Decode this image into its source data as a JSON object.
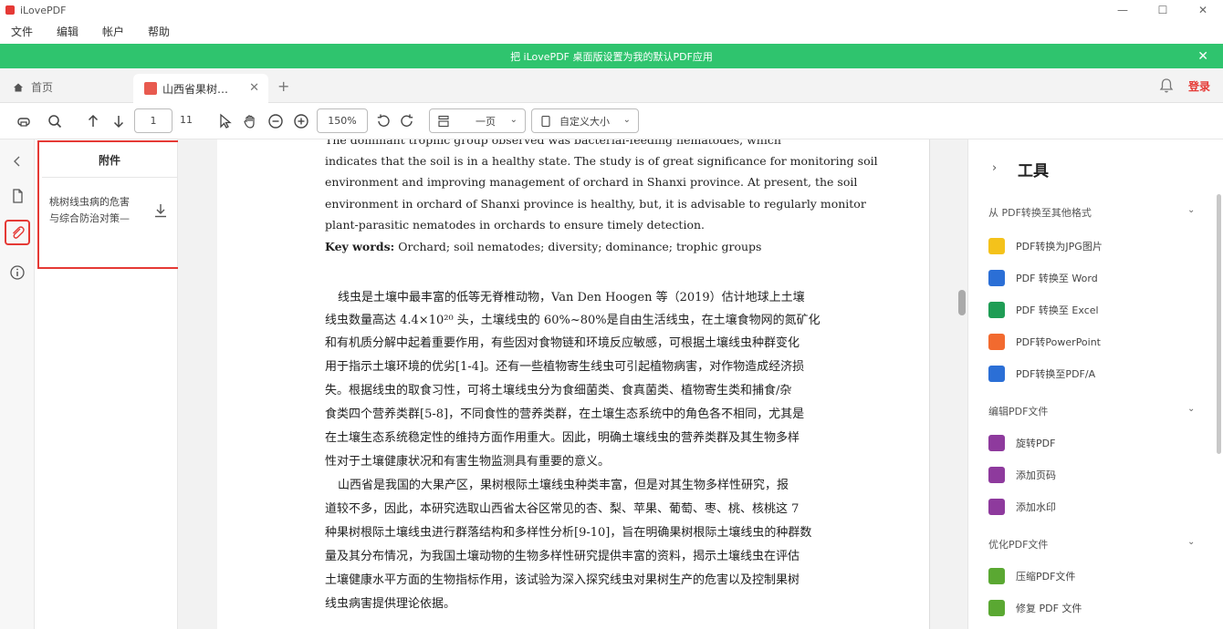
{
  "app": {
    "title": "iLovePDF",
    "window_controls": {
      "minimize": "—",
      "maximize": "☐",
      "close": "✕"
    }
  },
  "menubar": {
    "items": [
      "文件",
      "编辑",
      "帐户",
      "帮助"
    ]
  },
  "banner": {
    "text": "把 iLovePDF 桌面版设置为我的默认PDF应用",
    "close": "✕"
  },
  "tabs": {
    "home": "首页",
    "document": "山西省果树…",
    "close": "✕",
    "add": "+",
    "login": "登录"
  },
  "toolbar": {
    "page_current": "1",
    "page_total": "11",
    "zoom": "150%",
    "view_mode": "一页",
    "fit_mode": "自定义大小"
  },
  "attachments": {
    "header": "附件",
    "items": [
      {
        "line1": "桃树线虫病的危害",
        "line2": "与综合防治对策—"
      }
    ]
  },
  "document": {
    "english_lines": [
      "The dominant trophic group observed was bacterial-feeding nematodes, which",
      "indicates that the soil is in a healthy state. The study is of great significance for monitoring soil",
      "environment and improving management of orchard in Shanxi province. At present, the soil",
      "environment in orchard of Shanxi province is healthy, but, it is advisable to regularly monitor",
      "plant-parasitic nematodes in orchards to ensure timely detection."
    ],
    "keywords_label": "Key words:",
    "keywords": "Orchard; soil nematodes; diversity; dominance; trophic groups",
    "chinese_lines": [
      "线虫是土壤中最丰富的低等无脊椎动物，Van Den Hoogen 等（2019）估计地球上土壤",
      "线虫数量高达 4.4×10²⁰ 头，土壤线虫的 60%~80%是自由生活线虫，在土壤食物网的氮矿化",
      "和有机质分解中起着重要作用，有些因对食物链和环境反应敏感，可根据土壤线虫种群变化",
      "用于指示土壤环境的优劣[1-4]。还有一些植物寄生线虫可引起植物病害，对作物造成经济损",
      "失。根据线虫的取食习性，可将土壤线虫分为食细菌类、食真菌类、植物寄生类和捕食/杂",
      "食类四个营养类群[5-8]，不同食性的营养类群，在土壤生态系统中的角色各不相同，尤其是",
      "在土壤生态系统稳定性的维持方面作用重大。因此，明确土壤线虫的营养类群及其生物多样",
      "性对于土壤健康状况和有害生物监测具有重要的意义。",
      "山西省是我国的大果产区，果树根际土壤线虫种类丰富，但是对其生物多样性研究，报",
      "道较不多，因此，本研究选取山西省太谷区常见的杏、梨、苹果、葡萄、枣、桃、核桃这 7",
      "种果树根际土壤线虫进行群落结构和多样性分析[9-10]，旨在明确果树根际土壤线虫的种群数",
      "量及其分布情况，为我国土壤动物的生物多样性研究提供丰富的资料，揭示土壤线虫在评估",
      "土壤健康水平方面的生物指标作用，该试验为深入探究线虫对果树生产的危害以及控制果树",
      "线虫病害提供理论依据。"
    ]
  },
  "tools": {
    "title": "工具",
    "sections": [
      {
        "label": "从 PDF转换至其他格式",
        "items": [
          {
            "label": "PDF转换为JPG图片",
            "color": "#f4c21b"
          },
          {
            "label": "PDF 转换至 Word",
            "color": "#2b6fd6"
          },
          {
            "label": "PDF 转换至 Excel",
            "color": "#1f9d55"
          },
          {
            "label": "PDF转PowerPoint",
            "color": "#f26a2f"
          },
          {
            "label": "PDF转换至PDF/A",
            "color": "#2b6fd6"
          }
        ]
      },
      {
        "label": "编辑PDF文件",
        "items": [
          {
            "label": "旋转PDF",
            "color": "#8e3a9d"
          },
          {
            "label": "添加页码",
            "color": "#8e3a9d"
          },
          {
            "label": "添加水印",
            "color": "#8e3a9d"
          }
        ]
      },
      {
        "label": "优化PDF文件",
        "items": [
          {
            "label": "压缩PDF文件",
            "color": "#5aa832"
          },
          {
            "label": "修复 PDF 文件",
            "color": "#5aa832"
          }
        ]
      }
    ]
  },
  "icons": [
    "app-logo-icon",
    "home-icon",
    "pdf-file-icon",
    "bell-icon",
    "print-icon",
    "search-icon",
    "arrow-up-icon",
    "arrow-down-icon",
    "cursor-icon",
    "hand-icon",
    "zoom-out-icon",
    "zoom-in-icon",
    "rotate-left-icon",
    "rotate-right-icon",
    "page-view-icon",
    "page-size-icon",
    "collapse-left-icon",
    "pages-icon",
    "paperclip-icon",
    "info-icon",
    "download-icon",
    "chevron-right-icon",
    "chevron-down-icon"
  ],
  "colors": {
    "accent_green": "#2fc46e",
    "highlight_red": "#e53935"
  }
}
